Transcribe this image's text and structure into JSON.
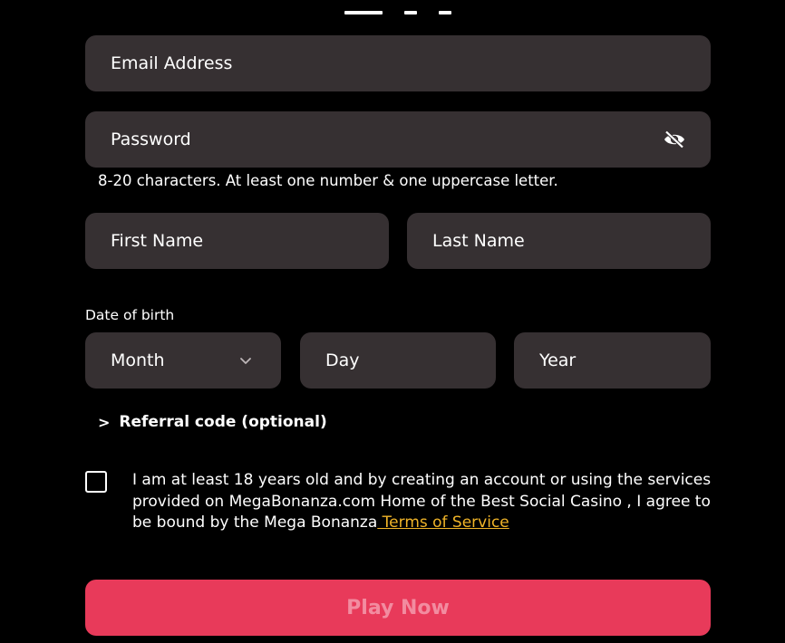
{
  "form": {
    "email": {
      "placeholder": "Email Address"
    },
    "password": {
      "placeholder": "Password",
      "toggle_icon": "eye-slash-icon",
      "hint": "8-20 characters. At least one number & one uppercase letter."
    },
    "first_name": {
      "placeholder": "First Name"
    },
    "last_name": {
      "placeholder": "Last Name"
    },
    "dob": {
      "label": "Date of birth",
      "month_placeholder": "Month",
      "day_placeholder": "Day",
      "year_placeholder": "Year"
    },
    "referral": {
      "label": "Referral code (optional)",
      "icon": "chevron-right-icon"
    },
    "consent": {
      "checked": false,
      "text": "I am at least 18 years old and by creating an account or using the services provided on MegaBonanza.com Home of the Best Social Casino , I agree to be bound by the Mega Bonanza",
      "link_text": " Terms of Service"
    },
    "submit_label": "Play Now"
  },
  "colors": {
    "background": "#000000",
    "field_background": "#363032",
    "primary_button": "#e83a5a",
    "primary_button_text": "#f28ca0",
    "link": "#f0b428"
  }
}
